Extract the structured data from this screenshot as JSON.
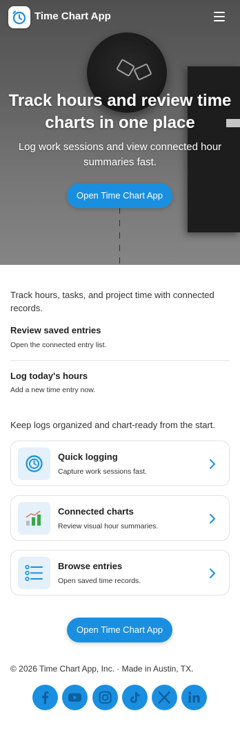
{
  "app": {
    "name": "Time Chart App"
  },
  "hero": {
    "title": "Track hours and review time charts in one place",
    "subtitle": "Log work sessions and view connected hour summaries fast.",
    "cta": "Open Time Chart App"
  },
  "intro": "Track hours, tasks, and project time with connected records.",
  "entries": [
    {
      "title": "Review saved entries",
      "desc": "Open the connected entry list."
    },
    {
      "title": "Log today's hours",
      "desc": "Add a new time entry now."
    }
  ],
  "tagline": "Keep logs organized and chart-ready from the start.",
  "features": [
    {
      "title": "Quick logging",
      "desc": "Capture work sessions fast.",
      "icon": "stopwatch-icon"
    },
    {
      "title": "Connected charts",
      "desc": "Review visual hour summaries.",
      "icon": "bar-chart-icon"
    },
    {
      "title": "Browse entries",
      "desc": "Open saved time records.",
      "icon": "list-icon"
    }
  ],
  "cta_bottom": "Open Time Chart App",
  "footer": "© 2026 Time Chart App, Inc. · Made in Austin, TX.",
  "social": [
    "facebook-icon",
    "youtube-icon",
    "instagram-icon",
    "tiktok-icon",
    "x-icon",
    "linkedin-icon"
  ],
  "colors": {
    "accent": "#1a8fe0",
    "card_border": "#e1e3e6",
    "icon_bg": "#e4f0fa",
    "bar_gray": "#b8bcc0",
    "bar_green": "#3aa84a"
  }
}
